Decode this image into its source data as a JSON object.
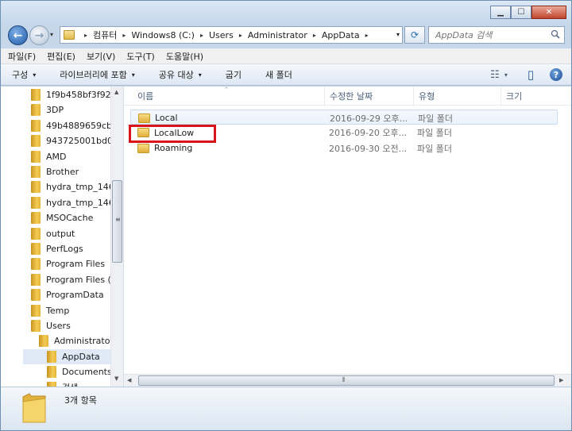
{
  "window": {
    "controls": {
      "minimize": "▁",
      "maximize": "☐",
      "close": "✕"
    }
  },
  "nav": {
    "back_glyph": "←",
    "forward_glyph": "→",
    "history_glyph": "▾",
    "breadcrumbs": [
      "컴퓨터",
      "Windows8 (C:)",
      "Users",
      "Administrator",
      "AppData"
    ],
    "separator": "▸",
    "dropdown_glyph": "▾",
    "refresh_glyph": "⟳",
    "search_placeholder": "AppData 검색"
  },
  "menu": [
    "파일(F)",
    "편집(E)",
    "보기(V)",
    "도구(T)",
    "도움말(H)"
  ],
  "toolbar": {
    "organize": "구성",
    "library": "라이브러리에 포함",
    "share": "공유 대상",
    "burn": "굽기",
    "new_folder": "새 폴더",
    "caret": "▾",
    "view_glyph": "☷",
    "preview_glyph": "▯",
    "help_glyph": "?"
  },
  "tree": [
    {
      "label": "1f9b458bf3f92",
      "indent": 0
    },
    {
      "label": "3DP",
      "indent": 0
    },
    {
      "label": "49b4889659cb",
      "indent": 0
    },
    {
      "label": "943725001bd0",
      "indent": 0
    },
    {
      "label": "AMD",
      "indent": 0
    },
    {
      "label": "Brother",
      "indent": 0
    },
    {
      "label": "hydra_tmp_146",
      "indent": 0
    },
    {
      "label": "hydra_tmp_146",
      "indent": 0
    },
    {
      "label": "MSOCache",
      "indent": 0
    },
    {
      "label": "output",
      "indent": 0
    },
    {
      "label": "PerfLogs",
      "indent": 0
    },
    {
      "label": "Program Files",
      "indent": 0
    },
    {
      "label": "Program Files (",
      "indent": 0
    },
    {
      "label": "ProgramData",
      "indent": 0
    },
    {
      "label": "Temp",
      "indent": 0
    },
    {
      "label": "Users",
      "indent": 0
    },
    {
      "label": "Administrato",
      "indent": 1
    },
    {
      "label": "AppData",
      "indent": 2,
      "selected": true
    },
    {
      "label": "Documents",
      "indent": 2
    },
    {
      "label": "검색",
      "indent": 2
    }
  ],
  "scroll": {
    "up": "▲",
    "down": "▼",
    "left": "◀",
    "right": "▶",
    "grip": "≡",
    "hgrip": "⦀"
  },
  "columns": {
    "name": "이름",
    "modified": "수정한 날짜",
    "type": "유형",
    "size": "크기",
    "sort_caret": "^"
  },
  "files": [
    {
      "name": "Local",
      "modified": "2016-09-29 오후...",
      "type": "파일 폴더",
      "size": ""
    },
    {
      "name": "LocalLow",
      "modified": "2016-09-20 오후...",
      "type": "파일 폴더",
      "size": ""
    },
    {
      "name": "Roaming",
      "modified": "2016-09-30 오전...",
      "type": "파일 폴더",
      "size": ""
    }
  ],
  "status": {
    "item_count": "3개 항목"
  },
  "colors": {
    "highlight": "#d9141b",
    "selection": "#dfeaf6"
  }
}
